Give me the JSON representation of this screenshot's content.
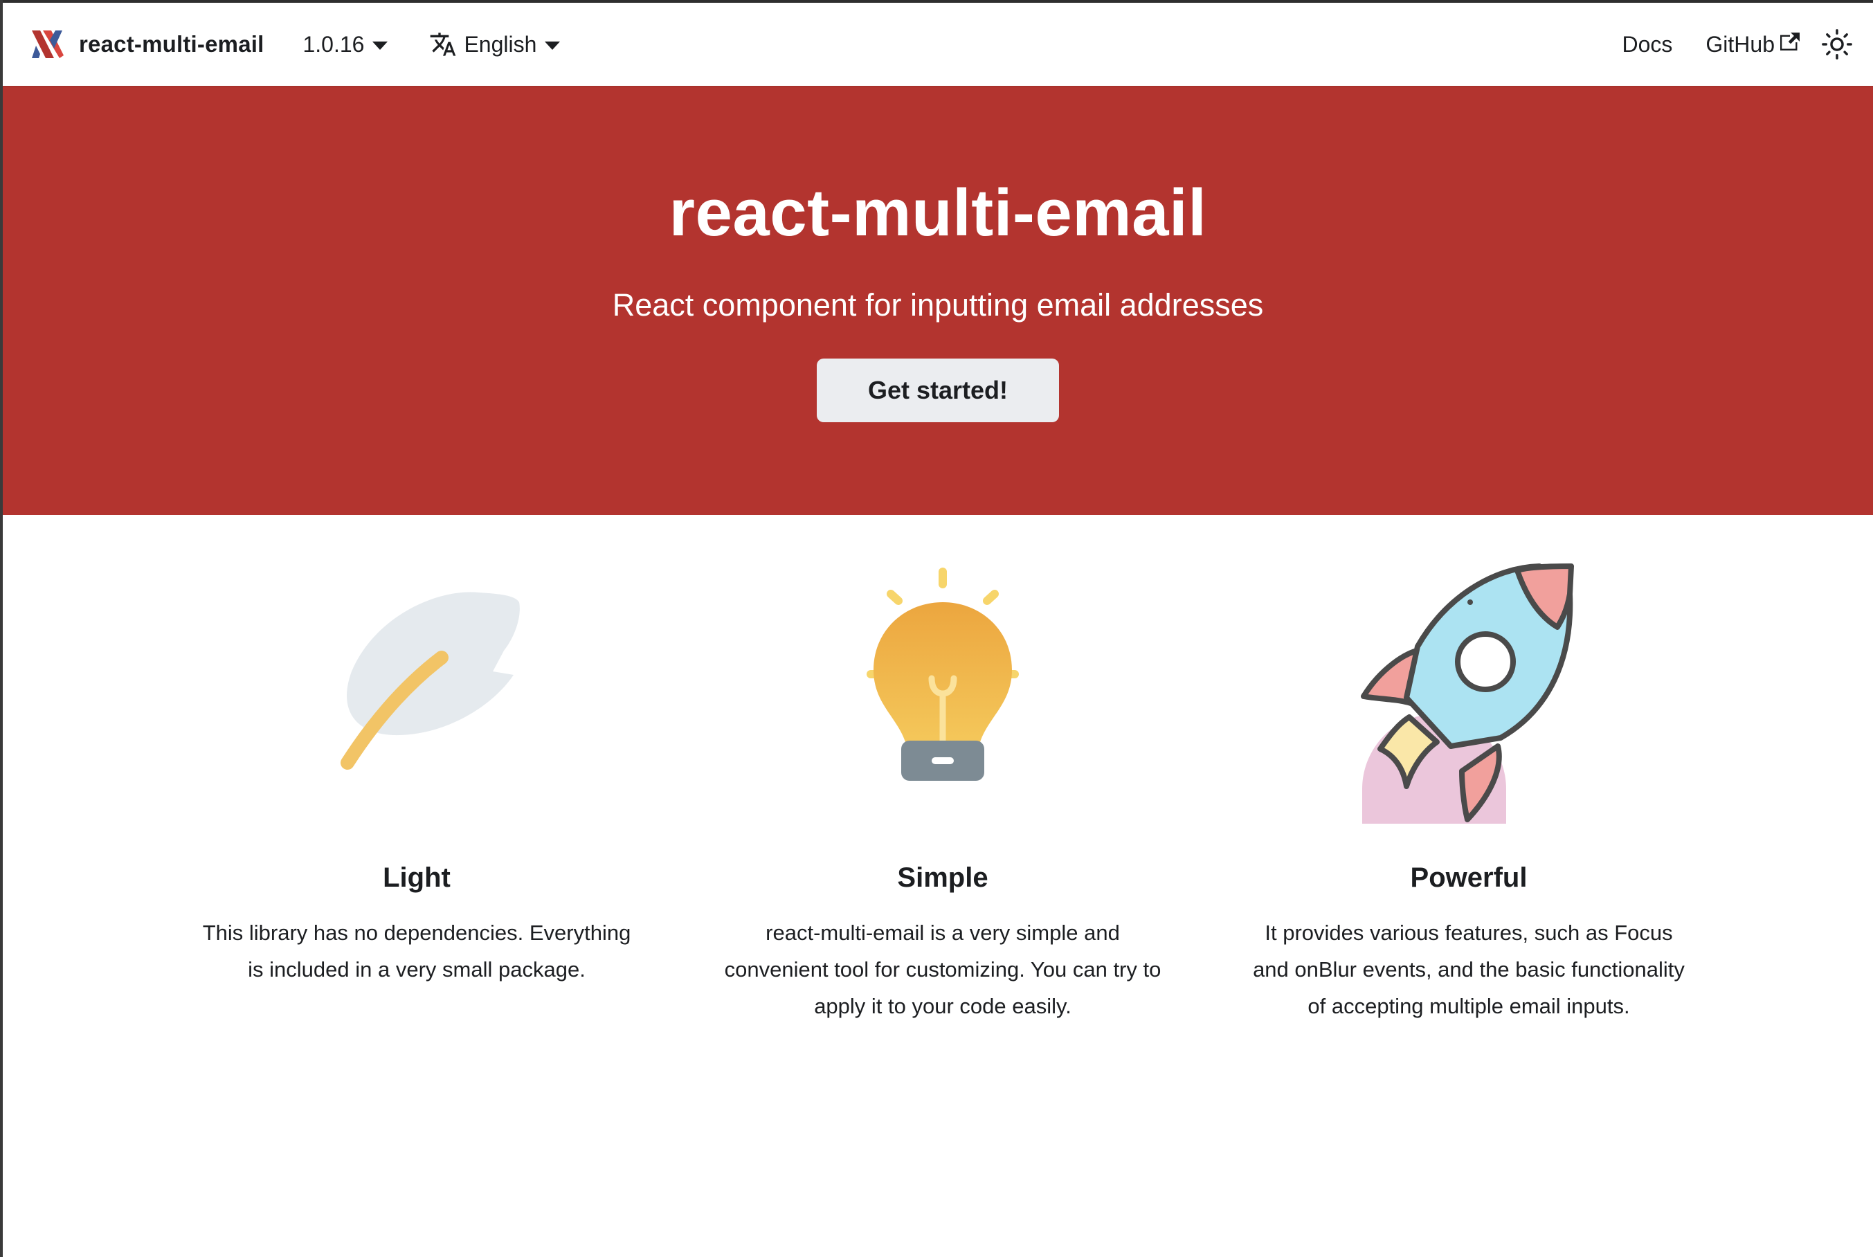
{
  "navbar": {
    "brand": "react-multi-email",
    "version": "1.0.16",
    "language": "English",
    "docs": "Docs",
    "github": "GitHub",
    "icons": {
      "logo": "react-multi-email-logo-icon",
      "translate": "translate-icon",
      "external": "external-link-icon",
      "theme": "sun-icon"
    }
  },
  "hero": {
    "title": "react-multi-email",
    "subtitle": "React component for inputting email addresses",
    "cta": "Get started!",
    "background": "#b3342f"
  },
  "features": [
    {
      "icon": "feather-icon",
      "title": "Light",
      "description": "This library has no dependencies. Everything is included in a very small package."
    },
    {
      "icon": "light-bulb-icon",
      "title": "Simple",
      "description": "react-multi-email is a very simple and convenient tool for customizing. You can try to apply it to your code easily."
    },
    {
      "icon": "rocket-icon",
      "title": "Powerful",
      "description": "It provides various features, such as Focus and onBlur events, and the basic functionality of accepting multiple email inputs."
    }
  ]
}
